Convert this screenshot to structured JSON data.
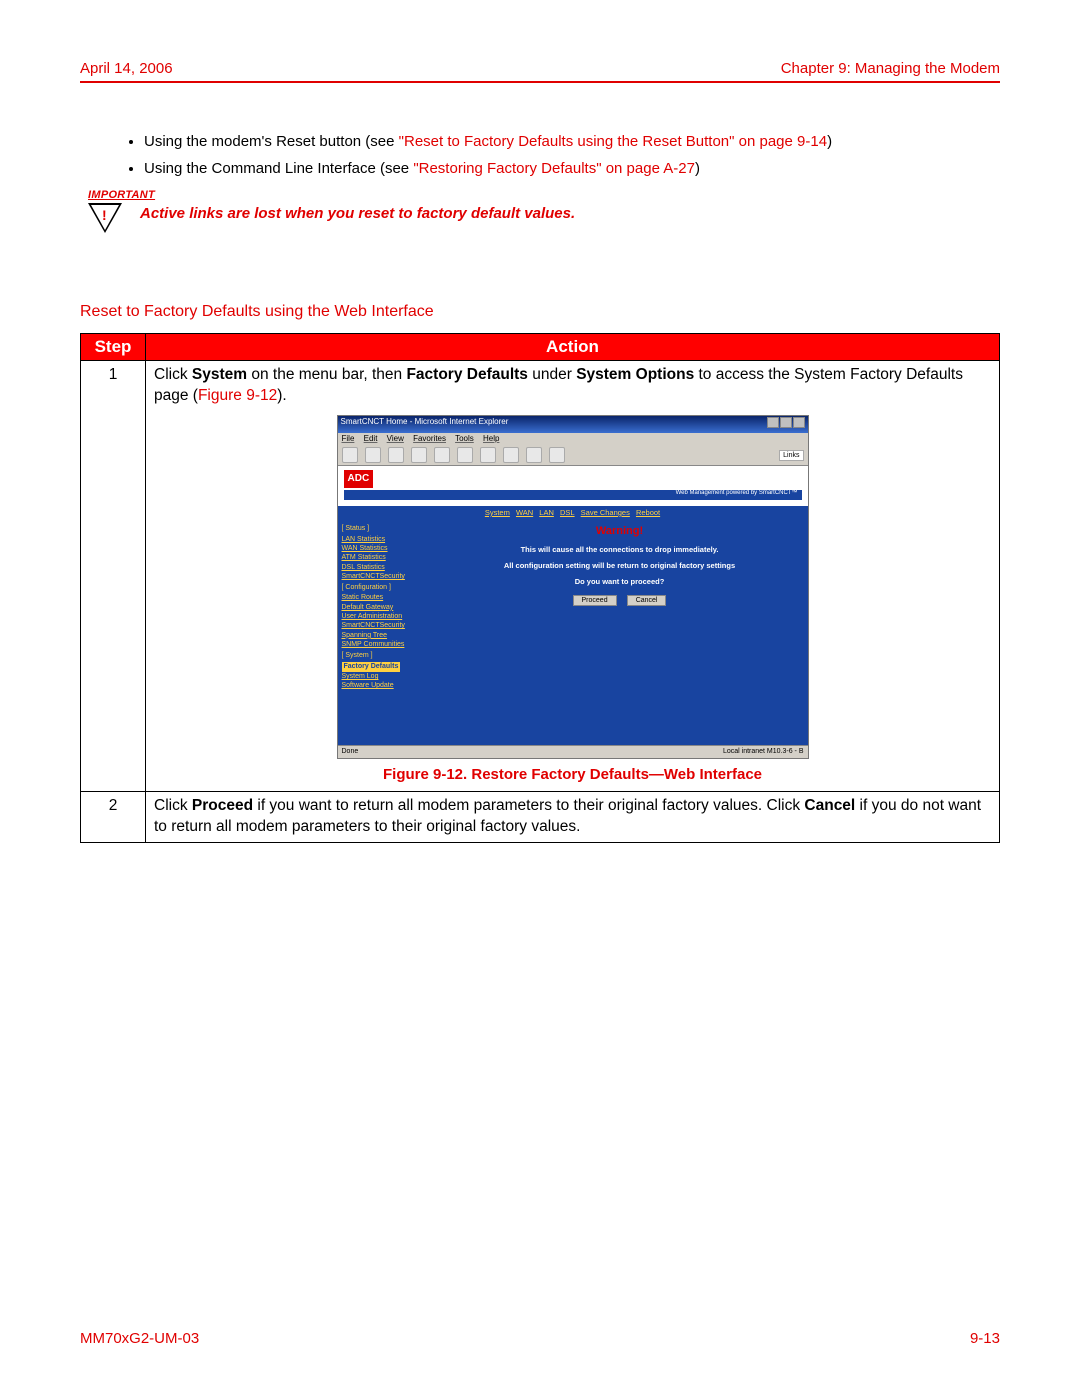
{
  "header": {
    "date": "April 14, 2006",
    "chapter": "Chapter 9: Managing the Modem"
  },
  "bullets": [
    {
      "lead": "Using the modem's Reset button (see ",
      "xref": "\"Reset to Factory Defaults using the Reset Button\" on page 9-14",
      "tail": ")"
    },
    {
      "lead": "Using the Command Line Interface (see ",
      "xref": "\"Restoring Factory Defaults\" on page A-27",
      "tail": ")"
    }
  ],
  "important": {
    "label": "IMPORTANT",
    "text": "Active links are lost when you reset to factory default values."
  },
  "section_heading": "Reset to Factory Defaults using the Web Interface",
  "table": {
    "head": {
      "step": "Step",
      "action": "Action"
    },
    "rows": [
      {
        "num": "1",
        "pre": "Click ",
        "b1": "System",
        "mid1": " on the menu bar, then ",
        "b2": "Factory Defaults",
        "mid2": " under ",
        "b3": "System Options",
        "mid3": " to access the System Factory Defaults page (",
        "figref": "Figure 9-12",
        "close": ")."
      },
      {
        "num": "2",
        "pre": "Click ",
        "b1": "Proceed",
        "mid1": " if you want to return all modem parameters to their original factory values. Click ",
        "b2": "Cancel",
        "mid2": " if you do not want to return all modem parameters to their original factory values.",
        "b3": "",
        "mid3": "",
        "figref": "",
        "close": ""
      }
    ]
  },
  "figure": {
    "title": "SmartCNCT Home - Microsoft Internet Explorer",
    "menus": [
      "File",
      "Edit",
      "View",
      "Favorites",
      "Tools",
      "Help"
    ],
    "toolbar": [
      "Back",
      "Fwd",
      "Stop",
      "Refresh",
      "Home",
      "Search",
      "Favorites",
      "History",
      "Mail",
      "Print"
    ],
    "links": "Links",
    "logo": "ADC",
    "strap": "Web Management powered by SmartCNCT™",
    "topnav": [
      "System",
      "WAN",
      "LAN",
      "DSL",
      "Save Changes",
      "Reboot"
    ],
    "side_groups": [
      {
        "title": "[ Status ]",
        "items": [
          "LAN Statistics",
          "WAN Statistics",
          "ATM Statistics",
          "DSL Statistics",
          "SmartCNCTSecurity"
        ]
      },
      {
        "title": "[ Configuration ]",
        "items": [
          "Static Routes",
          "Default Gateway",
          "User Administration",
          "SmartCNCTSecurity",
          "Spanning Tree",
          "SNMP Communities"
        ]
      },
      {
        "title": "[ System ]",
        "items": [
          "Factory Defaults",
          "System Log",
          "Software Update"
        ],
        "selected": 0
      }
    ],
    "warning_title": "Warning!",
    "warning_lines": [
      "This will cause all the connections to drop immediately.",
      "All configuration setting will be return to original factory settings",
      "Do you want to proceed?"
    ],
    "buttons": {
      "proceed": "Proceed",
      "cancel": "Cancel"
    },
    "status_left": "Done",
    "status_right": "Local intranet  M10.3-6 - B",
    "caption": "Figure 9-12. Restore Factory Defaults—Web Interface"
  },
  "footer": {
    "doc": "MM70xG2-UM-03",
    "page": "9-13"
  }
}
